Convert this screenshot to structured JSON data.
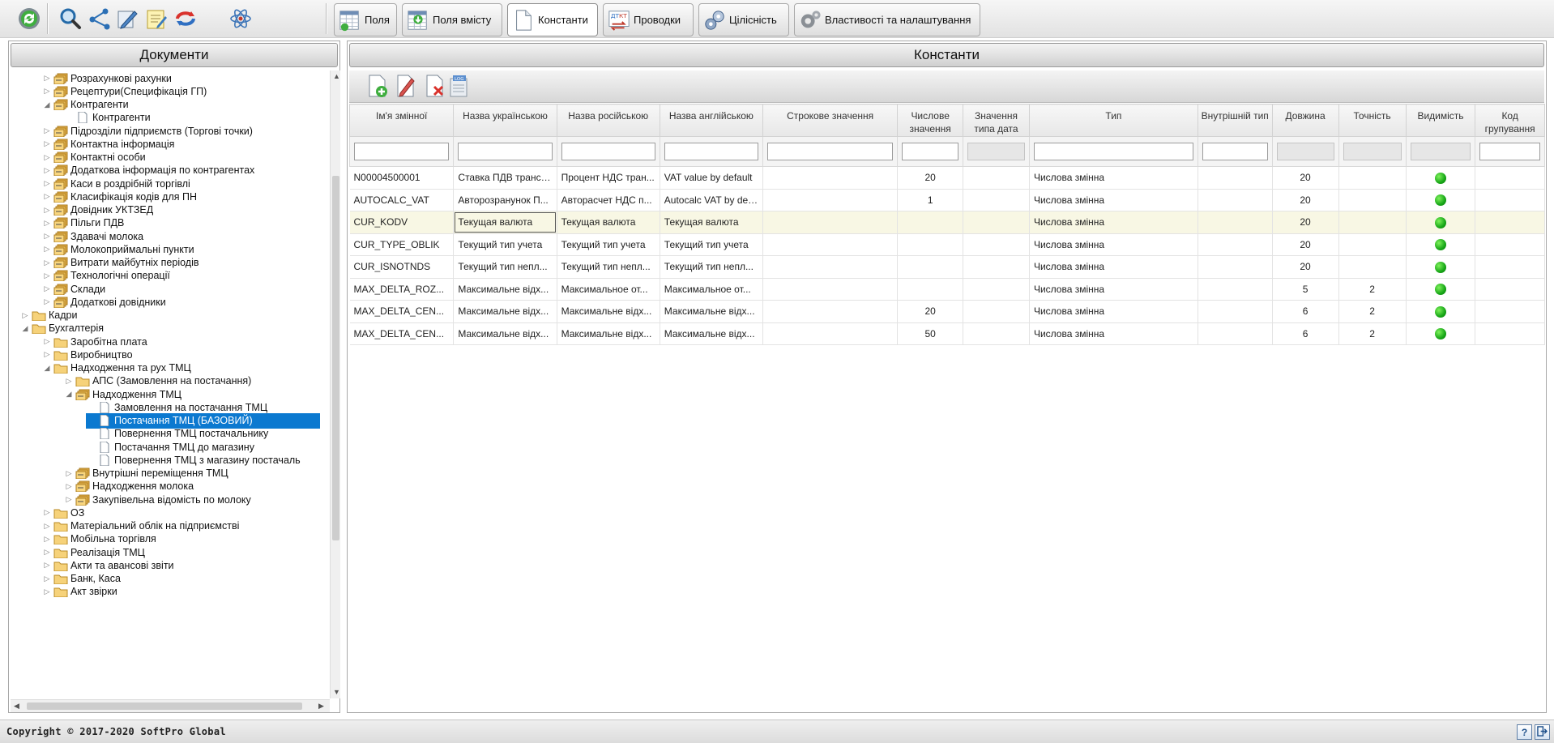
{
  "toolbar": {
    "icons": [
      "refresh-icon",
      "search-icon",
      "share-icon",
      "edit-icon",
      "notes-icon",
      "sync-icon",
      "atom-icon"
    ],
    "tabs": [
      {
        "label": "Поля",
        "icon": "fields-icon",
        "active": false
      },
      {
        "label": "Поля вмісту",
        "icon": "content-fields-icon",
        "active": false
      },
      {
        "label": "Константи",
        "icon": "document-icon",
        "active": true
      },
      {
        "label": "Проводки",
        "icon": "postings-icon",
        "active": false
      },
      {
        "label": "Цілісність",
        "icon": "integrity-icon",
        "active": false
      },
      {
        "label": "Властивості та налаштування",
        "icon": "gear-icon",
        "active": false
      }
    ]
  },
  "left_panel": {
    "title": "Документи",
    "tree": [
      {
        "label": "Розрахункові рахунки",
        "level": 2,
        "state": "collapsed",
        "icon": "stack"
      },
      {
        "label": "Рецептури(Специфікація ГП)",
        "level": 2,
        "state": "collapsed",
        "icon": "stack"
      },
      {
        "label": "Контрагенти",
        "level": 2,
        "state": "expanded",
        "icon": "stack"
      },
      {
        "label": "Контрагенти",
        "level": 3,
        "state": "leaf",
        "icon": "doc"
      },
      {
        "label": "Підрозділи підприємств (Торгові точки)",
        "level": 2,
        "state": "collapsed",
        "icon": "stack"
      },
      {
        "label": "Контактна інформація",
        "level": 2,
        "state": "collapsed",
        "icon": "stack"
      },
      {
        "label": "Контактні особи",
        "level": 2,
        "state": "collapsed",
        "icon": "stack"
      },
      {
        "label": "Додаткова інформація по контрагентах",
        "level": 2,
        "state": "collapsed",
        "icon": "stack"
      },
      {
        "label": "Каси в роздрібній торгівлі",
        "level": 2,
        "state": "collapsed",
        "icon": "stack"
      },
      {
        "label": "Класифікація кодів для ПН",
        "level": 2,
        "state": "collapsed",
        "icon": "stack"
      },
      {
        "label": "Довідник УКТЗЕД",
        "level": 2,
        "state": "collapsed",
        "icon": "stack"
      },
      {
        "label": "Пільги ПДВ",
        "level": 2,
        "state": "collapsed",
        "icon": "stack"
      },
      {
        "label": "Здавачі молока",
        "level": 2,
        "state": "collapsed",
        "icon": "stack"
      },
      {
        "label": "Молокоприймальні пункти",
        "level": 2,
        "state": "collapsed",
        "icon": "stack"
      },
      {
        "label": "Витрати майбутніх періодів",
        "level": 2,
        "state": "collapsed",
        "icon": "stack"
      },
      {
        "label": "Технологічні операції",
        "level": 2,
        "state": "collapsed",
        "icon": "stack"
      },
      {
        "label": "Склади",
        "level": 2,
        "state": "collapsed",
        "icon": "stack"
      },
      {
        "label": "Додаткові довідники",
        "level": 2,
        "state": "collapsed",
        "icon": "stack"
      },
      {
        "label": "Кадри",
        "level": 1,
        "state": "collapsed",
        "icon": "folder"
      },
      {
        "label": "Бухгалтерія",
        "level": 1,
        "state": "expanded",
        "icon": "folder"
      },
      {
        "label": "Заробітна плата",
        "level": 2,
        "state": "collapsed",
        "icon": "folder"
      },
      {
        "label": "Виробництво",
        "level": 2,
        "state": "collapsed",
        "icon": "folder"
      },
      {
        "label": "Надходження та рух ТМЦ",
        "level": 2,
        "state": "expanded",
        "icon": "folder"
      },
      {
        "label": "АПС (Замовлення на постачання)",
        "level": 3,
        "state": "collapsed",
        "icon": "folder"
      },
      {
        "label": "Надходження ТМЦ",
        "level": 3,
        "state": "expanded",
        "icon": "stack"
      },
      {
        "label": "Замовлення на постачання ТМЦ",
        "level": 4,
        "state": "leaf",
        "icon": "doc"
      },
      {
        "label": "Постачання ТМЦ (БАЗОВИЙ)",
        "level": 4,
        "state": "leaf",
        "icon": "doc",
        "selected": true
      },
      {
        "label": "Повернення ТМЦ постачальнику",
        "level": 4,
        "state": "leaf",
        "icon": "doc"
      },
      {
        "label": "Постачання ТМЦ до магазину",
        "level": 4,
        "state": "leaf",
        "icon": "doc"
      },
      {
        "label": "Повернення ТМЦ з магазину постачаль",
        "level": 4,
        "state": "leaf",
        "icon": "doc"
      },
      {
        "label": "Внутрішні переміщення ТМЦ",
        "level": 3,
        "state": "collapsed",
        "icon": "stack"
      },
      {
        "label": "Надходження молока",
        "level": 3,
        "state": "collapsed",
        "icon": "stack"
      },
      {
        "label": "Закупівельна відомість по молоку",
        "level": 3,
        "state": "collapsed",
        "icon": "stack"
      },
      {
        "label": "ОЗ",
        "level": 2,
        "state": "collapsed",
        "icon": "folder"
      },
      {
        "label": "Матеріальний облік на підприємстві",
        "level": 2,
        "state": "collapsed",
        "icon": "folder"
      },
      {
        "label": "Мобільна торгівля",
        "level": 2,
        "state": "collapsed",
        "icon": "folder"
      },
      {
        "label": "Реалізація ТМЦ",
        "level": 2,
        "state": "collapsed",
        "icon": "folder"
      },
      {
        "label": "Акти та авансові звіти",
        "level": 2,
        "state": "collapsed",
        "icon": "folder"
      },
      {
        "label": "Банк, Каса",
        "level": 2,
        "state": "collapsed",
        "icon": "folder"
      },
      {
        "label": "Акт звірки",
        "level": 2,
        "state": "collapsed",
        "icon": "folder"
      }
    ]
  },
  "right_panel": {
    "title": "Константи",
    "toolbar_icons": [
      "add-icon",
      "edit-pencil-icon",
      "delete-icon",
      "log-icon"
    ],
    "columns": [
      {
        "label": "Ім'я змінної",
        "filter": "text"
      },
      {
        "label": "Назва українською",
        "filter": "text"
      },
      {
        "label": "Назва російською",
        "filter": "text"
      },
      {
        "label": "Назва англійською",
        "filter": "text"
      },
      {
        "label": "Строкове значення",
        "filter": "text"
      },
      {
        "label": "Числове значення",
        "filter": "text"
      },
      {
        "label": "Значення типа дата",
        "filter": "disabled"
      },
      {
        "label": "Тип",
        "filter": "text"
      },
      {
        "label": "Внутрішній тип",
        "filter": "text"
      },
      {
        "label": "Довжина",
        "filter": "disabled"
      },
      {
        "label": "Точність",
        "filter": "disabled"
      },
      {
        "label": "Видимість",
        "filter": "disabled"
      },
      {
        "label": "Код групування",
        "filter": "text"
      }
    ],
    "rows": [
      {
        "cells": [
          "N00004500001",
          "Ставка ПДВ трансп...",
          "Процент НДС тран...",
          "VAT value by default",
          "",
          "20",
          "",
          "Числова змінна",
          "",
          "20",
          "",
          "",
          ""
        ],
        "visible": true,
        "selected": false
      },
      {
        "cells": [
          "AUTOCALC_VAT",
          "Авторозранунок П...",
          "Авторасчет НДС п...",
          "Autocalc VAT by def...",
          "",
          "1",
          "",
          "Числова змінна",
          "",
          "20",
          "",
          "",
          ""
        ],
        "visible": true,
        "selected": false
      },
      {
        "cells": [
          "CUR_KODV",
          "Текущая валюта",
          "Текущая валюта",
          "Текущая валюта",
          "",
          "",
          "",
          "Числова змінна",
          "",
          "20",
          "",
          "",
          ""
        ],
        "visible": true,
        "selected": true
      },
      {
        "cells": [
          "CUR_TYPE_OBLIK",
          "Текущий тип учета",
          "Текущий тип учета",
          "Текущий тип учета",
          "",
          "",
          "",
          "Числова змінна",
          "",
          "20",
          "",
          "",
          ""
        ],
        "visible": true,
        "selected": false
      },
      {
        "cells": [
          "CUR_ISNOTNDS",
          "Текущий тип непл...",
          "Текущий тип непл...",
          "Текущий тип непл...",
          "",
          "",
          "",
          "Числова змінна",
          "",
          "20",
          "",
          "",
          ""
        ],
        "visible": true,
        "selected": false
      },
      {
        "cells": [
          "MAX_DELTA_ROZ...",
          "Максимальне відх...",
          "Максимальное от...",
          "Максимальное от...",
          "",
          "",
          "",
          "Числова змінна",
          "",
          "5",
          "2",
          "",
          ""
        ],
        "visible": true,
        "selected": false
      },
      {
        "cells": [
          "MAX_DELTA_CEN...",
          "Максимальне відх...",
          "Максимальне відх...",
          "Максимальне відх...",
          "",
          "20",
          "",
          "Числова змінна",
          "",
          "6",
          "2",
          "",
          ""
        ],
        "visible": true,
        "selected": false
      },
      {
        "cells": [
          "MAX_DELTA_CEN...",
          "Максимальне відх...",
          "Максимальне відх...",
          "Максимальне відх...",
          "",
          "50",
          "",
          "Числова змінна",
          "",
          "6",
          "2",
          "",
          ""
        ],
        "visible": true,
        "selected": false
      }
    ]
  },
  "footer": {
    "copyright": "Copyright © 2017-2020 SoftPro Global",
    "help_label": "?",
    "exit_icon": "exit-icon"
  }
}
